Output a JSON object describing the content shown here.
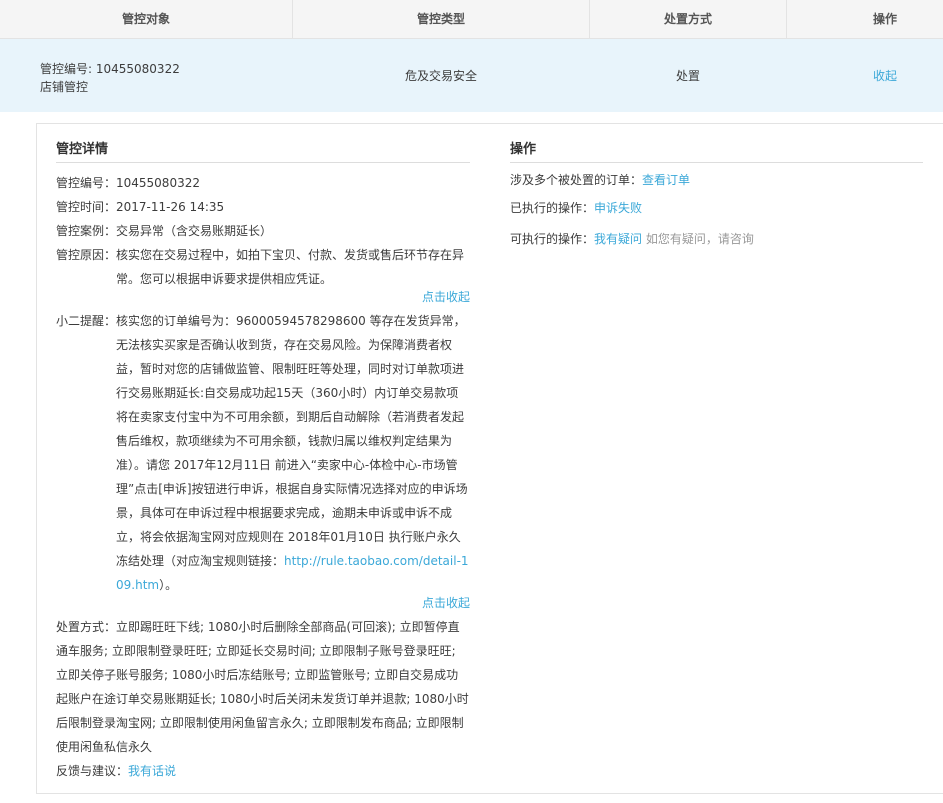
{
  "table": {
    "headers": [
      "管控对象",
      "管控类型",
      "处置方式",
      "操作"
    ],
    "row": {
      "obj_line1": "管控编号: 10455080322",
      "obj_line2": "店铺管控",
      "type": "危及交易安全",
      "method": "处置",
      "action": "收起"
    }
  },
  "detail": {
    "title": "管控详情",
    "id_label": "管控编号：",
    "id_value": "10455080322",
    "time_label": "管控时间：",
    "time_value": "2017-11-26 14:35",
    "case_label": "管控案例：",
    "case_value": "交易异常（含交易账期延长）",
    "reason_label": "管控原因：",
    "reason_value": "核实您在交易过程中，如拍下宝贝、付款、发货或售后环节存在异常。您可以根据申诉要求提供相应凭证。",
    "collapse1": "点击收起",
    "tip_label": "小二提醒：",
    "tip_value_pre": "核实您的订单编号为：96000594578298600 等存在发货异常，无法核实买家是否确认收到货，存在交易风险。为保障消费者权益，暂时对您的店铺做监管、限制旺旺等处理，同时对订单款项进行交易账期延长:自交易成功起15天（360小时）内订单交易款项将在卖家支付宝中为不可用余额，到期后自动解除（若消费者发起售后维权，款项继续为不可用余额，钱款归属以维权判定结果为准）。请您 2017年12月11日 前进入“卖家中心-体检中心-市场管理”点击[申诉]按钮进行申诉，根据自身实际情况选择对应的申诉场景，具体可在申诉过程中根据要求完成，逾期未申诉或申诉不成立，将会依据淘宝网对应规则在 2018年01月10日 执行账户永久冻结处理（对应淘宝规则链接：",
    "tip_link": "http://rule.taobao.com/detail-109.htm",
    "tip_value_post": "）。",
    "collapse2": "点击收起",
    "measures": "处置方式：立即踢旺旺下线; 1080小时后删除全部商品(可回滚); 立即暂停直通车服务; 立即限制登录旺旺; 立即延长交易时间; 立即限制子账号登录旺旺; 立即关停子账号服务; 1080小时后冻结账号; 立即监管账号; 立即自交易成功起账户在途订单交易账期延长; 1080小时后关闭未发货订单并退款; 1080小时后限制登录淘宝网; 立即限制使用闲鱼留言永久; 立即限制发布商品; 立即限制使用闲鱼私信永久",
    "feedback_label": "反馈与建议：",
    "feedback_link": "我有话说"
  },
  "ops": {
    "title": "操作",
    "line1_label": "涉及多个被处置的订单：",
    "line1_link": "查看订单",
    "line2_label": "已执行的操作：",
    "line2_link": "申诉失败",
    "line3_label": "可执行的操作：",
    "line3_link": "我有疑问",
    "line3_hint": "如您有疑问，请咨询"
  },
  "colors": {
    "link": "#3ba8d8",
    "row_bg": "#e8f4fb",
    "header_bg": "#f5f5f5"
  }
}
